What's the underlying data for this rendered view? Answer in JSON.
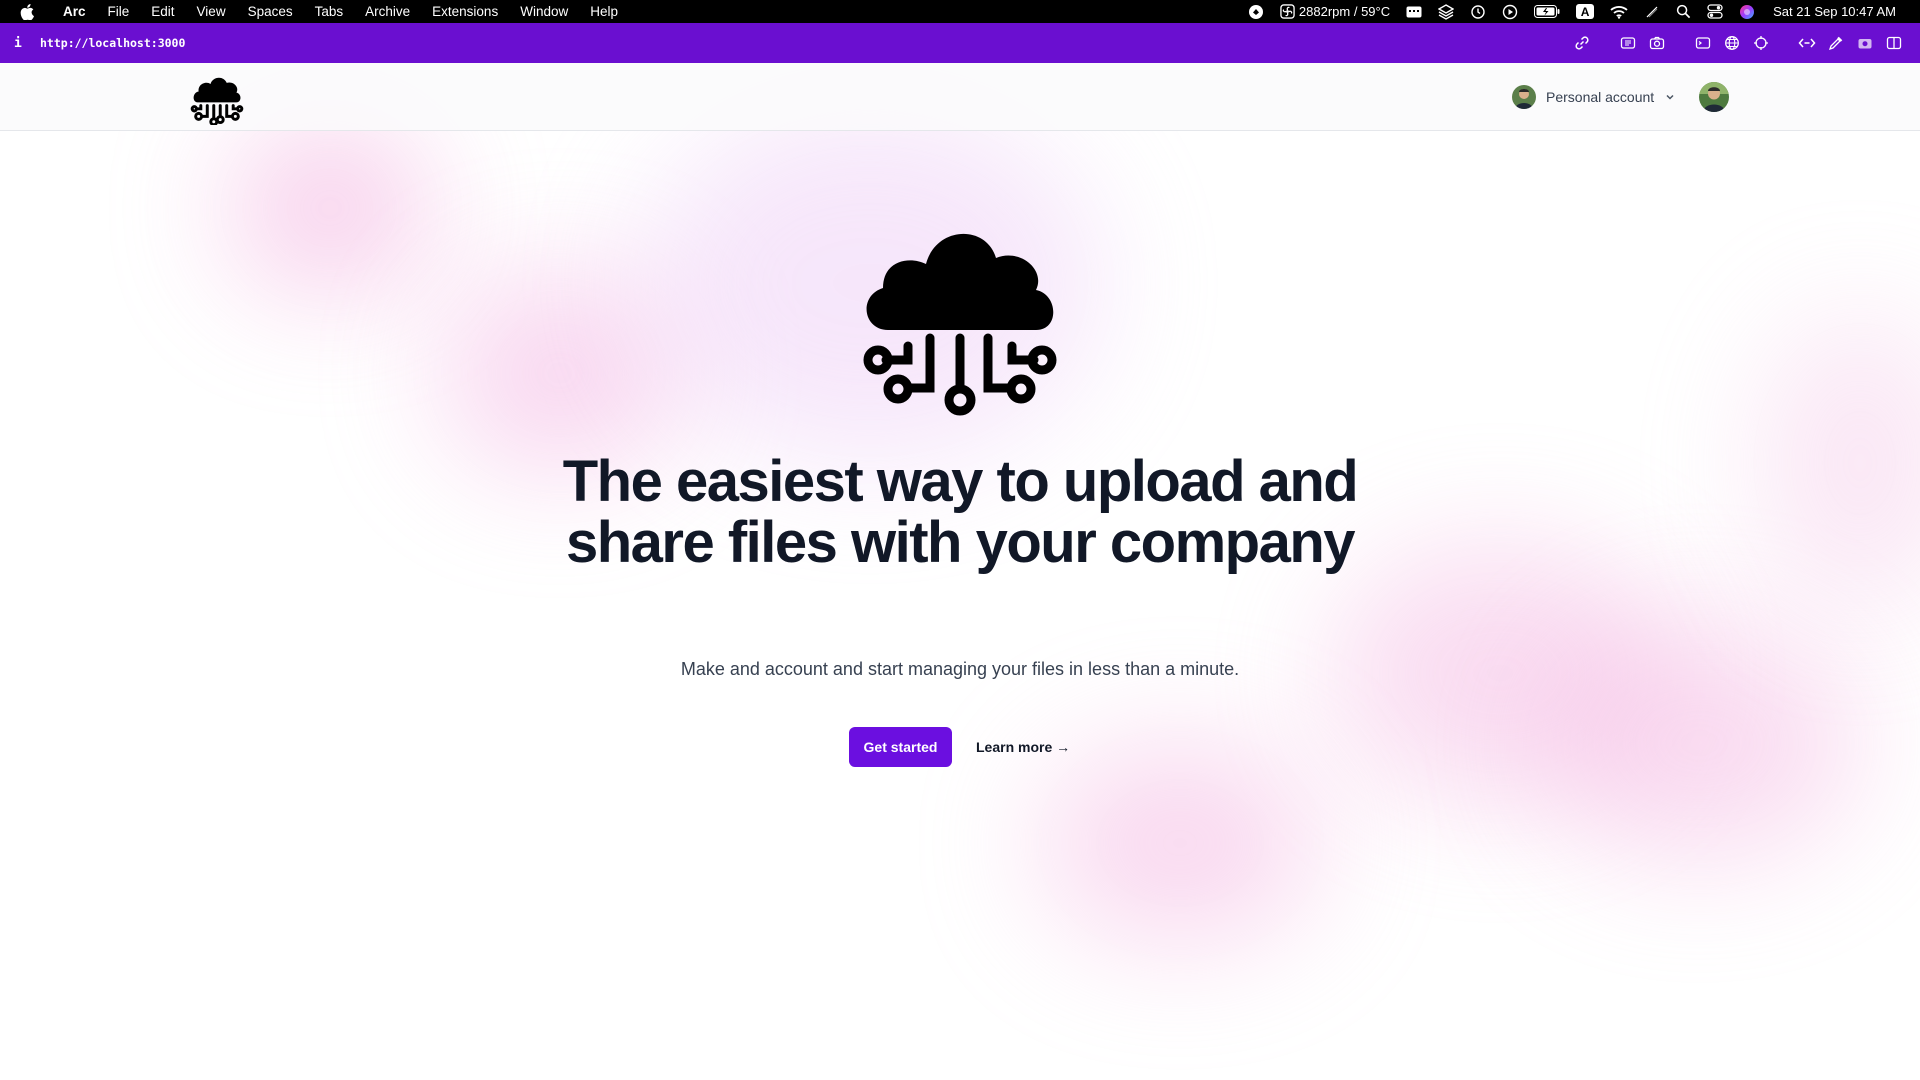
{
  "menubar": {
    "app_name": "Arc",
    "items": [
      "File",
      "Edit",
      "View",
      "Spaces",
      "Tabs",
      "Archive",
      "Extensions",
      "Window",
      "Help"
    ],
    "fan_status": "2882rpm / 59°C",
    "keyboard_input": "A",
    "datetime": "Sat 21 Sep  10:47 AM"
  },
  "urlbar": {
    "info_glyph": "i",
    "url": "http://localhost:3000",
    "color": "#6a0fd0"
  },
  "site": {
    "account_label": "Personal account",
    "headline": "The easiest way to upload and share files with your company",
    "subline": "Make and account and start managing your files in less than a minute.",
    "cta_label": "Get started",
    "learn_label": "Learn more →",
    "accent_color": "#6b0fe0"
  },
  "icons": {
    "logo": "cloud-circuit-icon",
    "chevron": "chevron-down-icon"
  }
}
